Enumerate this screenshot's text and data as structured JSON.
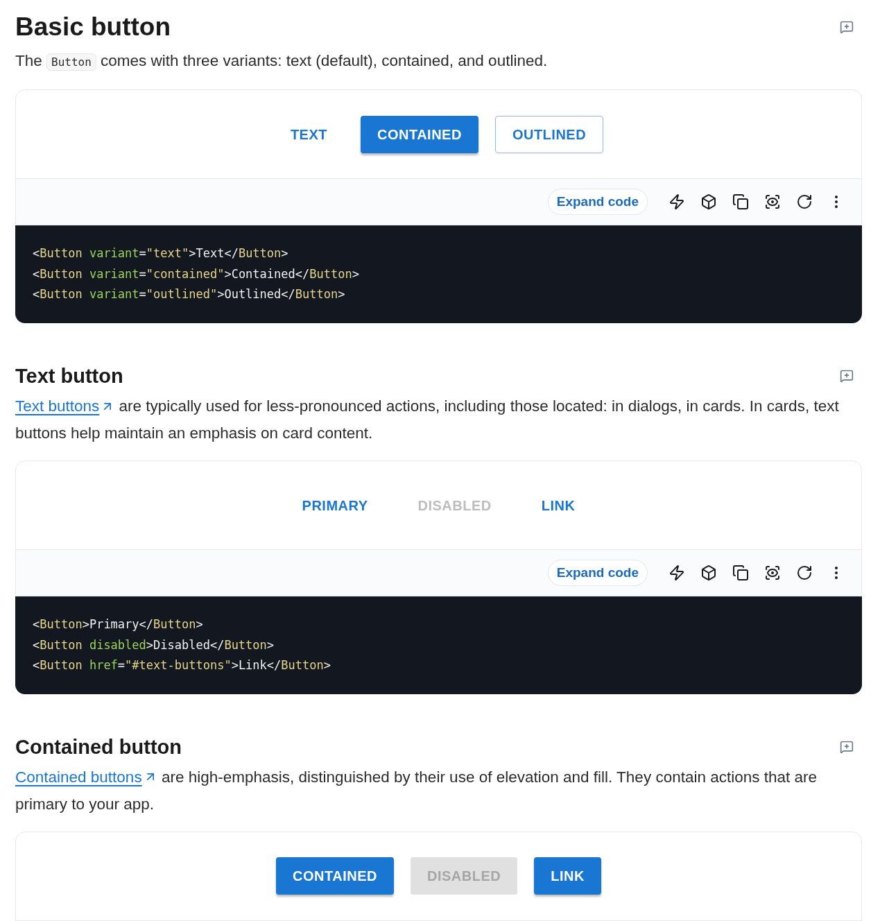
{
  "sections": [
    {
      "title": "Basic button",
      "intro": [
        {
          "kind": "text",
          "text": "The "
        },
        {
          "kind": "code",
          "text": "Button"
        },
        {
          "kind": "text",
          "text": " comes with three variants: text (default), contained, and outlined."
        }
      ],
      "demo": {
        "buttons": [
          {
            "label": "TEXT",
            "kind": "text",
            "disabled": false
          },
          {
            "label": "CONTAINED",
            "kind": "contained",
            "disabled": false
          },
          {
            "label": "OUTLINED",
            "kind": "outlined",
            "disabled": false
          }
        ]
      },
      "toolbar": {
        "expand_label": "Expand code"
      },
      "code": [
        [
          {
            "kind": "punct",
            "text": "<"
          },
          {
            "kind": "tag",
            "text": "Button"
          },
          {
            "kind": "attr",
            "text": " variant"
          },
          {
            "kind": "punct",
            "text": "="
          },
          {
            "kind": "string",
            "text": "\"text\""
          },
          {
            "kind": "punct",
            "text": ">Text</"
          },
          {
            "kind": "tag",
            "text": "Button"
          },
          {
            "kind": "punct",
            "text": ">"
          }
        ],
        [
          {
            "kind": "punct",
            "text": "<"
          },
          {
            "kind": "tag",
            "text": "Button"
          },
          {
            "kind": "attr",
            "text": " variant"
          },
          {
            "kind": "punct",
            "text": "="
          },
          {
            "kind": "string",
            "text": "\"contained\""
          },
          {
            "kind": "punct",
            "text": ">Contained</"
          },
          {
            "kind": "tag",
            "text": "Button"
          },
          {
            "kind": "punct",
            "text": ">"
          }
        ],
        [
          {
            "kind": "punct",
            "text": "<"
          },
          {
            "kind": "tag",
            "text": "Button"
          },
          {
            "kind": "attr",
            "text": " variant"
          },
          {
            "kind": "punct",
            "text": "="
          },
          {
            "kind": "string",
            "text": "\"outlined\""
          },
          {
            "kind": "punct",
            "text": ">Outlined</"
          },
          {
            "kind": "tag",
            "text": "Button"
          },
          {
            "kind": "punct",
            "text": ">"
          }
        ]
      ]
    },
    {
      "title": "Text button",
      "intro": [
        {
          "kind": "link",
          "text": "Text buttons"
        },
        {
          "kind": "text",
          "text": " are typically used for less-pronounced actions, including those located: in dialogs, in cards. In cards, text buttons help maintain an emphasis on card content."
        }
      ],
      "demo": {
        "buttons": [
          {
            "label": "PRIMARY",
            "kind": "text",
            "disabled": false
          },
          {
            "label": "DISABLED",
            "kind": "text",
            "disabled": true
          },
          {
            "label": "LINK",
            "kind": "text",
            "disabled": false
          }
        ]
      },
      "toolbar": {
        "expand_label": "Expand code"
      },
      "code": [
        [
          {
            "kind": "punct",
            "text": "<"
          },
          {
            "kind": "tag",
            "text": "Button"
          },
          {
            "kind": "punct",
            "text": ">Primary</"
          },
          {
            "kind": "tag",
            "text": "Button"
          },
          {
            "kind": "punct",
            "text": ">"
          }
        ],
        [
          {
            "kind": "punct",
            "text": "<"
          },
          {
            "kind": "tag",
            "text": "Button"
          },
          {
            "kind": "attr",
            "text": " disabled"
          },
          {
            "kind": "punct",
            "text": ">Disabled</"
          },
          {
            "kind": "tag",
            "text": "Button"
          },
          {
            "kind": "punct",
            "text": ">"
          }
        ],
        [
          {
            "kind": "punct",
            "text": "<"
          },
          {
            "kind": "tag",
            "text": "Button"
          },
          {
            "kind": "attr",
            "text": " href"
          },
          {
            "kind": "punct",
            "text": "="
          },
          {
            "kind": "string",
            "text": "\"#text-buttons\""
          },
          {
            "kind": "punct",
            "text": ">Link</"
          },
          {
            "kind": "tag",
            "text": "Button"
          },
          {
            "kind": "punct",
            "text": ">"
          }
        ]
      ]
    },
    {
      "title": "Contained button",
      "intro": [
        {
          "kind": "link",
          "text": "Contained buttons"
        },
        {
          "kind": "text",
          "text": " are high-emphasis, distinguished by their use of elevation and fill. They contain actions that are primary to your app."
        }
      ],
      "demo": {
        "buttons": [
          {
            "label": "CONTAINED",
            "kind": "contained",
            "disabled": false
          },
          {
            "label": "DISABLED",
            "kind": "contained",
            "disabled": true
          },
          {
            "label": "LINK",
            "kind": "contained",
            "disabled": false
          }
        ]
      }
    }
  ]
}
